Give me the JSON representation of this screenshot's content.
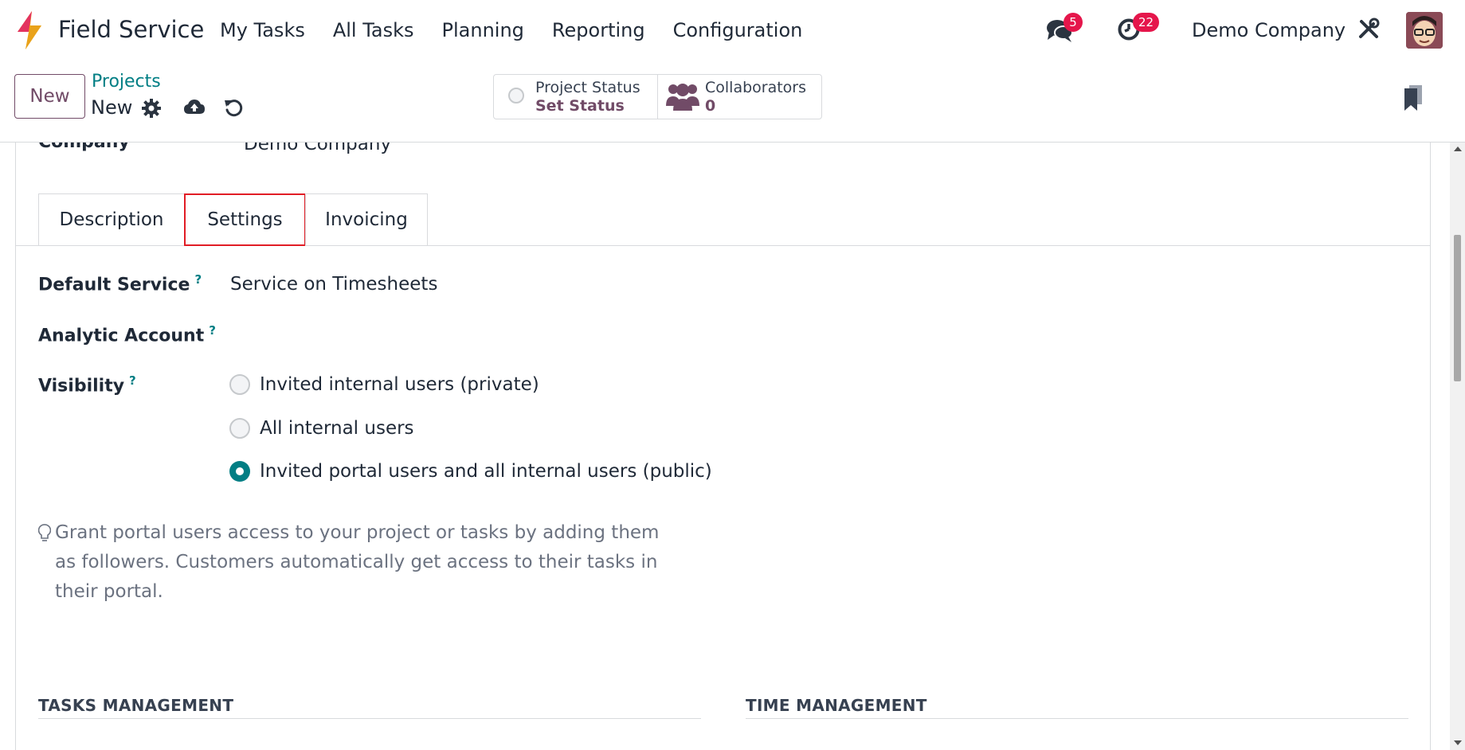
{
  "navbar": {
    "app_name": "Field Service",
    "menu": [
      "My Tasks",
      "All Tasks",
      "Planning",
      "Reporting",
      "Configuration"
    ],
    "messages_count": "5",
    "activities_count": "22",
    "company": "Demo Company",
    "accent_color": "#714b67",
    "badge_color": "#e5164b"
  },
  "control_panel": {
    "new_label": "New",
    "breadcrumb_parent": "Projects",
    "breadcrumb_current": "New",
    "project_status_label": "Project Status",
    "project_status_value": "Set Status",
    "collaborators_label": "Collaborators",
    "collaborators_count": "0"
  },
  "form": {
    "company_label": "Company",
    "company_value": "Demo Company",
    "tabs": [
      "Description",
      "Settings",
      "Invoicing"
    ],
    "active_tab": "Settings",
    "default_service_label": "Default Service",
    "default_service_value": "Service on Timesheets",
    "analytic_account_label": "Analytic Account",
    "visibility_label": "Visibility",
    "help_mark": "?",
    "visibility_options": [
      "Invited internal users (private)",
      "All internal users",
      "Invited portal users and all internal users (public)"
    ],
    "visibility_selected": "Invited portal users and all internal users (public)",
    "hint": "Grant portal users access to your project or tasks by adding them as followers. Customers automatically get access to their tasks in their portal.",
    "section_tasks": "TASKS MANAGEMENT",
    "section_time": "TIME MANAGEMENT"
  }
}
